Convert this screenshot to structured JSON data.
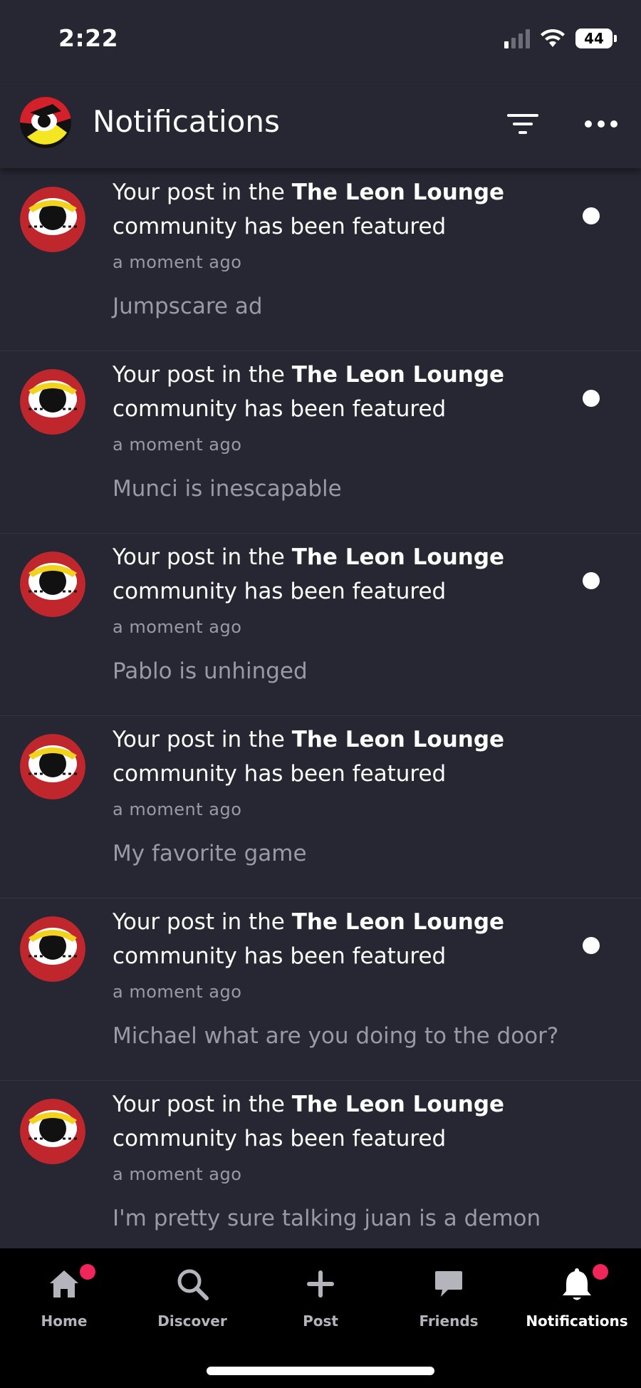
{
  "status_bar": {
    "time": "2:22",
    "battery": "44"
  },
  "header": {
    "title": "Notifications"
  },
  "notifications": [
    {
      "prefix": "Your post in the ",
      "community": "The Leon Lounge",
      "suffix": "community has been featured",
      "time": "a moment ago",
      "post": "Jumpscare ad",
      "unread": true
    },
    {
      "prefix": "Your post in the ",
      "community": "The Leon Lounge",
      "suffix": "community has been featured",
      "time": "a moment ago",
      "post": "Munci is inescapable",
      "unread": true
    },
    {
      "prefix": "Your post in the ",
      "community": "The Leon Lounge",
      "suffix": "community has been featured",
      "time": "a moment ago",
      "post": "Pablo is unhinged",
      "unread": true
    },
    {
      "prefix": "Your post in the ",
      "community": "The Leon Lounge",
      "suffix": "community has been featured",
      "time": "a moment ago",
      "post": "My favorite game",
      "unread": false
    },
    {
      "prefix": "Your post in the ",
      "community": "The Leon Lounge",
      "suffix": "community has been featured",
      "time": "a moment ago",
      "post": "Michael what are you doing to the door?",
      "unread": true
    },
    {
      "prefix": "Your post in the ",
      "community": "The Leon Lounge",
      "suffix": "community has been featured",
      "time": "a moment ago",
      "post": "I'm pretty sure talking juan is a demon",
      "unread": false
    }
  ],
  "tabs": [
    {
      "label": "Home",
      "icon": "home-icon",
      "badge": true,
      "active": false
    },
    {
      "label": "Discover",
      "icon": "search-icon",
      "badge": false,
      "active": false
    },
    {
      "label": "Post",
      "icon": "plus-icon",
      "badge": false,
      "active": false
    },
    {
      "label": "Friends",
      "icon": "chat-bubble-icon",
      "badge": false,
      "active": false
    },
    {
      "label": "Notifications",
      "icon": "bell-icon",
      "badge": true,
      "active": true
    }
  ],
  "colors": {
    "background": "#272734",
    "tab_bar": "#000000",
    "badge": "#f0265a",
    "muted_text": "#9a9aa5"
  }
}
